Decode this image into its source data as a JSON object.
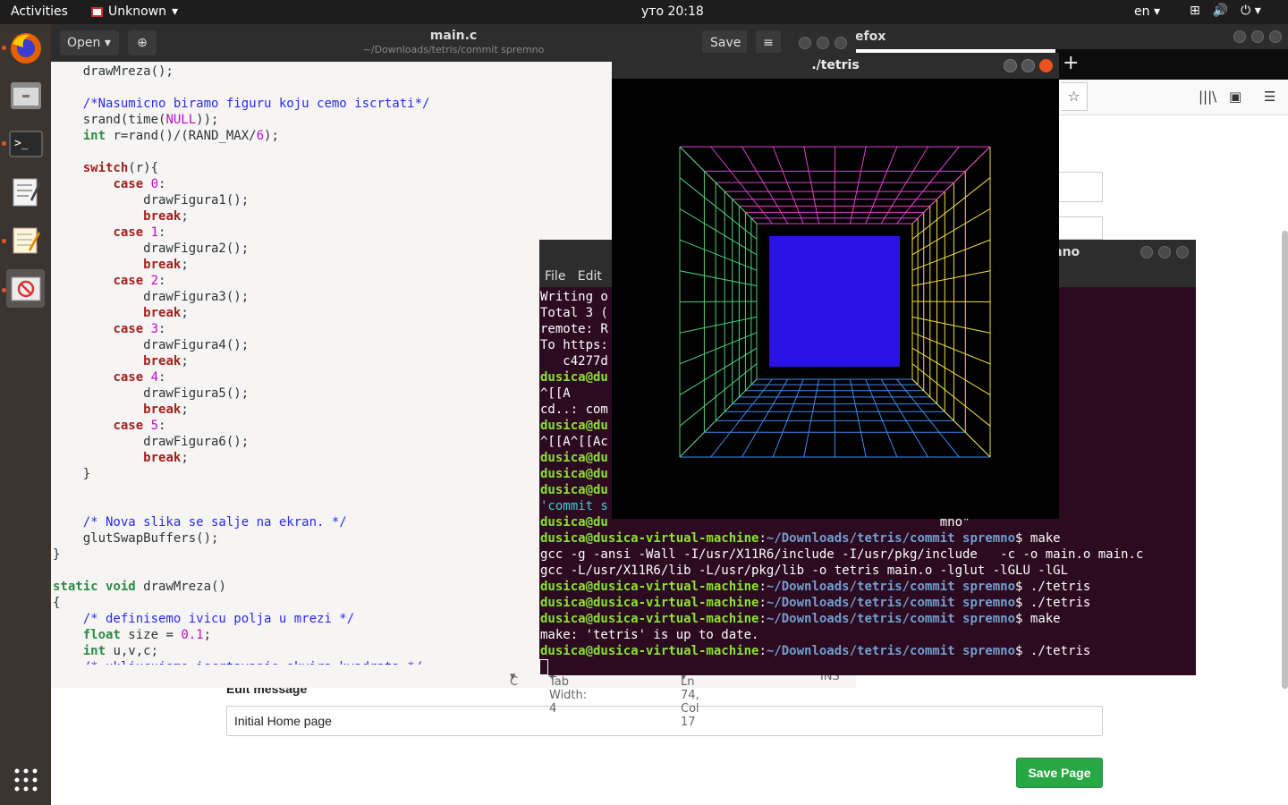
{
  "topbar": {
    "activities": "Activities",
    "app_name": "Unknown",
    "clock": "уто 20:18",
    "lang": "en"
  },
  "dock": {
    "items": [
      "firefox-icon",
      "files-icon",
      "terminal-icon",
      "text-editor-icon",
      "notes-icon",
      "unknown-app-icon"
    ],
    "apps_grid": "show-applications-icon"
  },
  "firefox": {
    "title_fragment": "efox",
    "edit_label": "Edit message",
    "message_value": "Initial Home page",
    "save_label": "Save Page",
    "accent": "#28a745"
  },
  "gedit": {
    "open_label": "Open",
    "title": "main.c",
    "subtitle": "~/Downloads/tetris/commit spremno",
    "save_label": "Save",
    "status": {
      "lang": "C",
      "tab_width": "Tab Width: 4",
      "position": "Ln 74, Col 17",
      "mode": "INS"
    }
  },
  "terminal": {
    "title_fragment": "mno",
    "menu_file": "File",
    "menu_edit": "Edit",
    "bg": "#2c0a20"
  },
  "tetris": {
    "title": "./tetris",
    "fill": "#2a12e6"
  }
}
